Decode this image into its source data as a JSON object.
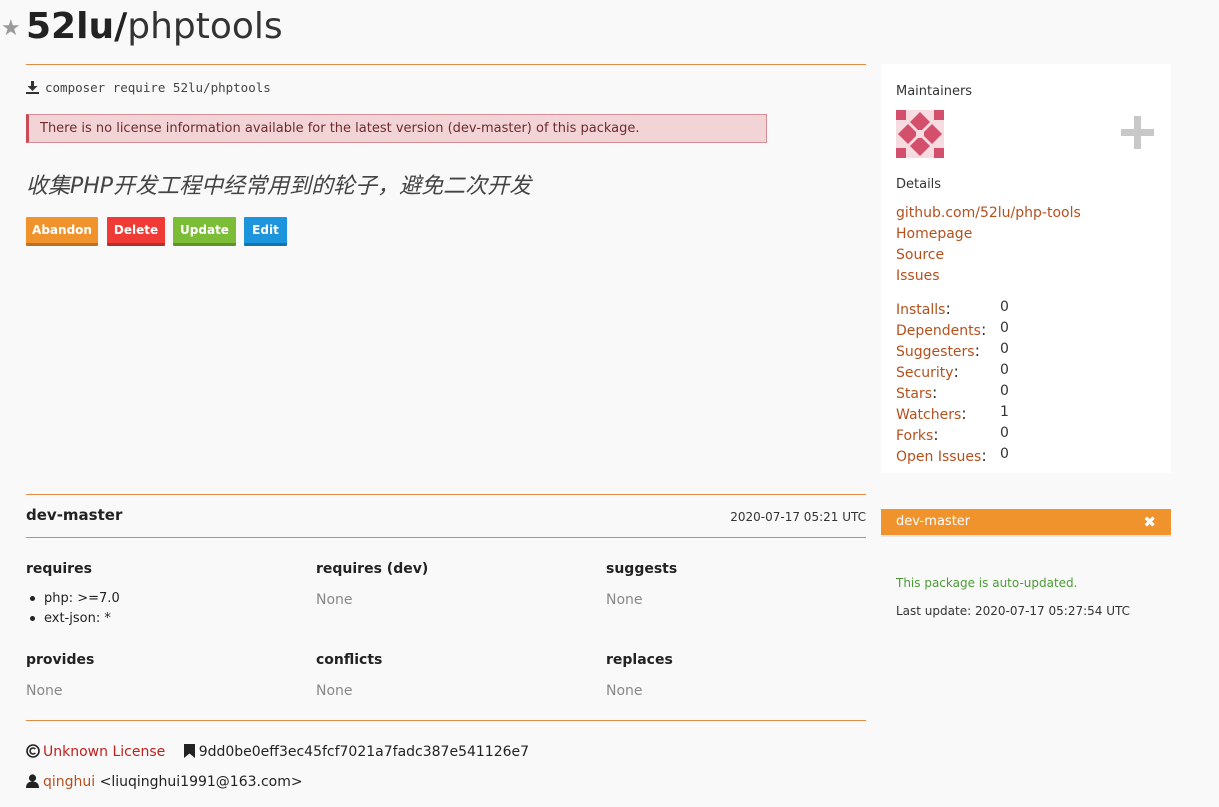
{
  "header": {
    "star_icon": "star-icon",
    "vendor": "52lu/",
    "package": "phptools"
  },
  "install": {
    "icon": "download-icon",
    "command": "composer require 52lu/phptools"
  },
  "alert": {
    "text": "There is no license information available for the latest version (dev-master) of this package."
  },
  "description": "收集PHP开发工程中经常用到的轮子，避免二次开发",
  "actions": {
    "abandon": "Abandon",
    "delete": "Delete",
    "update": "Update",
    "edit": "Edit"
  },
  "sidebar": {
    "maintainers_heading": "Maintainers",
    "details_heading": "Details",
    "links": [
      "github.com/52lu/php-tools",
      "Homepage",
      "Source",
      "Issues"
    ],
    "stats": [
      {
        "label": "Installs",
        "value": "0"
      },
      {
        "label": "Dependents",
        "value": "0"
      },
      {
        "label": "Suggesters",
        "value": "0"
      },
      {
        "label": "Security",
        "value": "0"
      },
      {
        "label": "Stars",
        "value": "0"
      },
      {
        "label": "Watchers",
        "value": "1"
      },
      {
        "label": "Forks",
        "value": "0"
      },
      {
        "label": "Open Issues",
        "value": "0"
      }
    ],
    "stat_colon": ":",
    "avatar_color": "#d44f6b",
    "accent_color": "#b5501d"
  },
  "version_panel": {
    "selected": "dev-master",
    "auto_updated": "This package is auto-updated.",
    "last_update": "Last update: 2020-07-17 05:27:54 UTC"
  },
  "version": {
    "name": "dev-master",
    "date": "2020-07-17 05:21 UTC",
    "requires_heading": "requires",
    "requires": [
      "php: >=7.0",
      "ext-json: *"
    ],
    "requires_dev_heading": "requires (dev)",
    "requires_dev": "None",
    "suggests_heading": "suggests",
    "suggests": "None",
    "provides_heading": "provides",
    "provides": "None",
    "conflicts_heading": "conflicts",
    "conflicts": "None",
    "replaces_heading": "replaces",
    "replaces": "None"
  },
  "footer": {
    "license": "Unknown License",
    "commit": "9dd0be0eff3ec45fcf7021a7fadc387e541126e7",
    "author_name": "qinghui",
    "author_email": "<liuqinghui1991@163.com>"
  }
}
